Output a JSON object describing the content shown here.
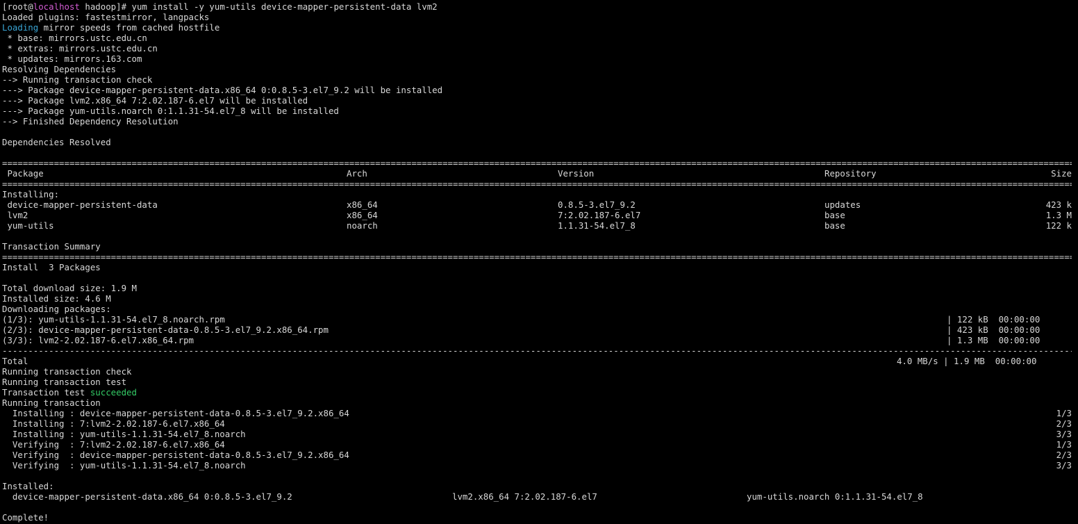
{
  "prompt": {
    "open": "[root@",
    "host": "localhost",
    "dir": " hadoop]# ",
    "command": "yum install -y yum-utils device-mapper-persistent-data lvm2"
  },
  "intro_lines": [
    "Loaded plugins: fastestmirror, langpacks"
  ],
  "loading": {
    "word": "Loading",
    "rest": " mirror speeds from cached hostfile"
  },
  "mirror_lines": [
    " * base: mirrors.ustc.edu.cn",
    " * extras: mirrors.ustc.edu.cn",
    " * updates: mirrors.163.com",
    "Resolving Dependencies",
    "--> Running transaction check",
    "---> Package device-mapper-persistent-data.x86_64 0:0.8.5-3.el7_9.2 will be installed",
    "---> Package lvm2.x86_64 7:2.02.187-6.el7 will be installed",
    "---> Package yum-utils.noarch 0:1.1.31-54.el7_8 will be installed",
    "--> Finished Dependency Resolution",
    "",
    "Dependencies Resolved",
    ""
  ],
  "table": {
    "headers": {
      "package": " Package",
      "arch": "Arch",
      "version": "Version",
      "repository": "Repository",
      "size": "Size"
    },
    "installing_label": "Installing:",
    "rows": [
      {
        "package": " device-mapper-persistent-data",
        "arch": "x86_64",
        "version": "0.8.5-3.el7_9.2",
        "repository": "updates",
        "size": "423 k"
      },
      {
        "package": " lvm2",
        "arch": "x86_64",
        "version": "7:2.02.187-6.el7",
        "repository": "base",
        "size": "1.3 M"
      },
      {
        "package": " yum-utils",
        "arch": "noarch",
        "version": "1.1.31-54.el7_8",
        "repository": "base",
        "size": "122 k"
      }
    ]
  },
  "summary": {
    "title": "Transaction Summary",
    "install_line": "Install  3 Packages",
    "total_download": "Total download size: 1.9 M",
    "installed_size": "Installed size: 4.6 M",
    "downloading": "Downloading packages:"
  },
  "downloads": [
    {
      "name": "(1/3): yum-utils-1.1.31-54.el7_8.noarch.rpm",
      "stats": "| 122 kB  00:00:00"
    },
    {
      "name": "(2/3): device-mapper-persistent-data-0.8.5-3.el7_9.2.x86_64.rpm",
      "stats": "| 423 kB  00:00:00"
    },
    {
      "name": "(3/3): lvm2-2.02.187-6.el7.x86_64.rpm",
      "stats": "| 1.3 MB  00:00:00"
    }
  ],
  "total": {
    "label": "Total",
    "stats": "4.0 MB/s | 1.9 MB  00:00:00"
  },
  "transaction": {
    "check": "Running transaction check",
    "test": "Running transaction test",
    "test_prefix": "Transaction test ",
    "test_result": "succeeded",
    "running": "Running transaction"
  },
  "steps": [
    {
      "text": "  Installing : device-mapper-persistent-data-0.8.5-3.el7_9.2.x86_64",
      "count": "1/3"
    },
    {
      "text": "  Installing : 7:lvm2-2.02.187-6.el7.x86_64",
      "count": "2/3"
    },
    {
      "text": "  Installing : yum-utils-1.1.31-54.el7_8.noarch",
      "count": "3/3"
    },
    {
      "text": "  Verifying  : 7:lvm2-2.02.187-6.el7.x86_64",
      "count": "1/3"
    },
    {
      "text": "  Verifying  : device-mapper-persistent-data-0.8.5-3.el7_9.2.x86_64",
      "count": "2/3"
    },
    {
      "text": "  Verifying  : yum-utils-1.1.31-54.el7_8.noarch",
      "count": "3/3"
    }
  ],
  "installed": {
    "label": "Installed:",
    "items": [
      "  device-mapper-persistent-data.x86_64 0:0.8.5-3.el7_9.2",
      "lvm2.x86_64 7:2.02.187-6.el7",
      "yum-utils.noarch 0:1.1.31-54.el7_8"
    ]
  },
  "complete": "Complete!",
  "colors": {
    "background": "#000000",
    "foreground": "#d8d8d8",
    "host": "#d35cd3",
    "loading": "#3aa6d6",
    "success": "#33cc66"
  }
}
